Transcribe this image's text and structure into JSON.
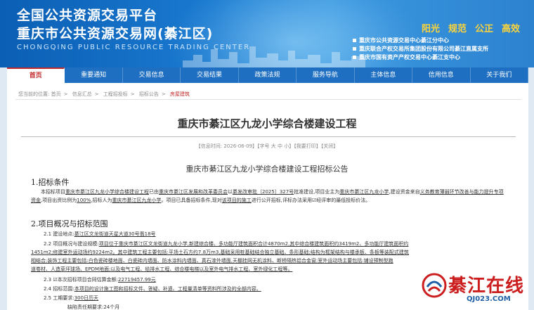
{
  "header": {
    "title_main": "全国公共资源交易平台",
    "title_sub": "重庆市公共资源交易网(綦江区)",
    "title_en": "CHONGQING PUBLIC RESOURCE TRADING CENTER",
    "slogans": [
      "阳光",
      "规范",
      "公正",
      "高效"
    ],
    "orgs": [
      "重庆市公共资源交易中心綦江分中心",
      "重庆联合产权交易所集团股份有限公司綦江直属支所",
      "重庆市国有资产产权交易中心綦江支中心"
    ]
  },
  "nav": {
    "items": [
      "首页",
      "重要通知",
      "交易信息",
      "交易结果",
      "政策法规",
      "服务导航",
      "主体信息",
      "信用信息",
      "关于我们"
    ]
  },
  "breadcrumb": {
    "prefix": "您当前的位置:",
    "items": [
      "首页",
      "信息汇总",
      "工程招投标",
      "招标公告"
    ],
    "current": "房屋建筑"
  },
  "article": {
    "title": "重庆市綦江区九龙小学综合楼建设工程",
    "meta": "【信息时间: 2026-06-09】【字号 大 中 小】【我要打印】【关闭】",
    "subtitle": "重庆市綦江区九龙小学综合楼建设工程招标公告",
    "section1": "1.招标条件",
    "p1": {
      "a": "本招标项目",
      "b": "重庆市綦江区九龙小学综合楼建设工程",
      "c": "已由",
      "d": "重庆市綦江区发展和改革委员会",
      "e": "以",
      "f": "綦发改审批〔2025〕327号",
      "g": "批准建设,项目业主为",
      "h": "重庆市綦江区九龙小学",
      "i": ",建设资金来自",
      "j": "义务教育薄弱环节改善与能力提升专项资金",
      "k": ",项目出资比例为",
      "l": "100%",
      "m": ",招标人为",
      "n": "重庆市綦江区九龙小学",
      "o": "。项目已具备招标条件,现对",
      "p": "该项目的施工",
      "q": "进行公开招标,评标办法采用☑经评审的最低投标价法。"
    },
    "section2": "2.项目概况与招标范围",
    "r1_label": "2.1 建设地点:",
    "r1_value": "綦江区文龙街道天星大道30号翡18号",
    "r2_label": "2.2 项目概况与建设规模:",
    "r2_line1": "项目位于重庆市綦江区文龙街道九龙小学,新建综合楼、多功能厅建筑面积合计4870m2,其中综合楼建筑面积约3419m2、多功能厅建筑面积约",
    "r2_line2": "1451m2;修建室外运动场约9224m2。其中建筑工程主要包括:平场土石方约7.8万m3,基础采用桩基础结合独立基础、条形基础;结构为框架结构与楼承板、条板等装配式建筑",
    "r2_line3": "相结合;装饰工程主要包括:白色瓷砖楼地面、白瓷砖内墙面、防水涂料内墙面、真石漆外墙面,天棚挂网无机涂料、断桥隔热铝合金窗;室外运动场主要包括:铺设预制型跑",
    "r2_line4": "道卷材、人造草坪球场、EPDM地面;以及电气工程、给排水工程、综合楼电梯以及室外电气排水工程、室外绿化工程等。",
    "r3_label": "2.3 ☑本次招标项目合同估算金额:",
    "r3_value": "22719457.99元",
    "r4_label": "2.4 招标范围:",
    "r4_value": "本项目的设计施工图和招标文件、答疑、补遗、工程量清单等资料所涉及的全部内容。",
    "r5_label": "2.5 工期要求:",
    "r5_value": "300日历天",
    "r6_label": "缺陷责任期要求:24个月"
  },
  "watermark": {
    "text": "綦江在线",
    "url": "QJ023.COM"
  }
}
